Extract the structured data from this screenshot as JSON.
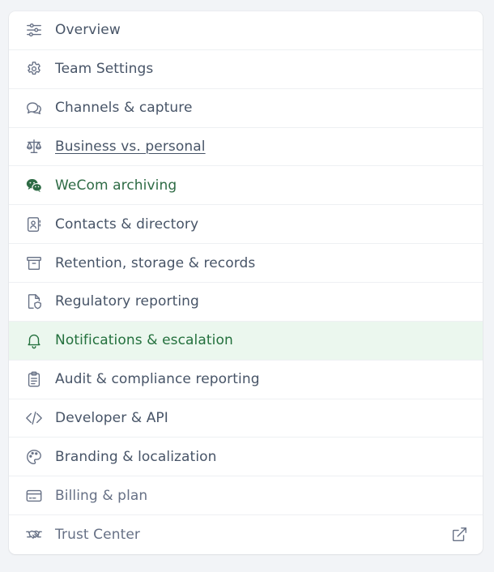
{
  "menu": {
    "items": [
      {
        "label": "Overview",
        "icon": "sliders-icon"
      },
      {
        "label": "Team Settings",
        "icon": "gear-icon"
      },
      {
        "label": "Channels & capture",
        "icon": "chat-bubbles-icon"
      },
      {
        "label": "Business vs. personal",
        "icon": "scale-icon"
      },
      {
        "label": "WeCom archiving",
        "icon": "wechat-icon"
      },
      {
        "label": "Contacts & directory",
        "icon": "contact-book-icon"
      },
      {
        "label": "Retention, storage & records",
        "icon": "archive-box-icon"
      },
      {
        "label": "Regulatory reporting",
        "icon": "file-shield-icon"
      },
      {
        "label": "Notifications & escalation",
        "icon": "bell-icon"
      },
      {
        "label": "Audit & compliance reporting",
        "icon": "clipboard-icon"
      },
      {
        "label": "Developer & API",
        "icon": "code-icon"
      },
      {
        "label": "Branding & localization",
        "icon": "palette-icon"
      },
      {
        "label": "Billing & plan",
        "icon": "credit-card-icon"
      },
      {
        "label": "Trust Center",
        "icon": "handshake-icon",
        "trailing_icon": "external-link-icon"
      }
    ],
    "active_index": 8
  },
  "colors": {
    "text": "#475467",
    "active_text": "#23703d",
    "active_bg": "#ebf7ee",
    "wecom_green": "#2e6b45",
    "icon_gray": "#667085"
  }
}
